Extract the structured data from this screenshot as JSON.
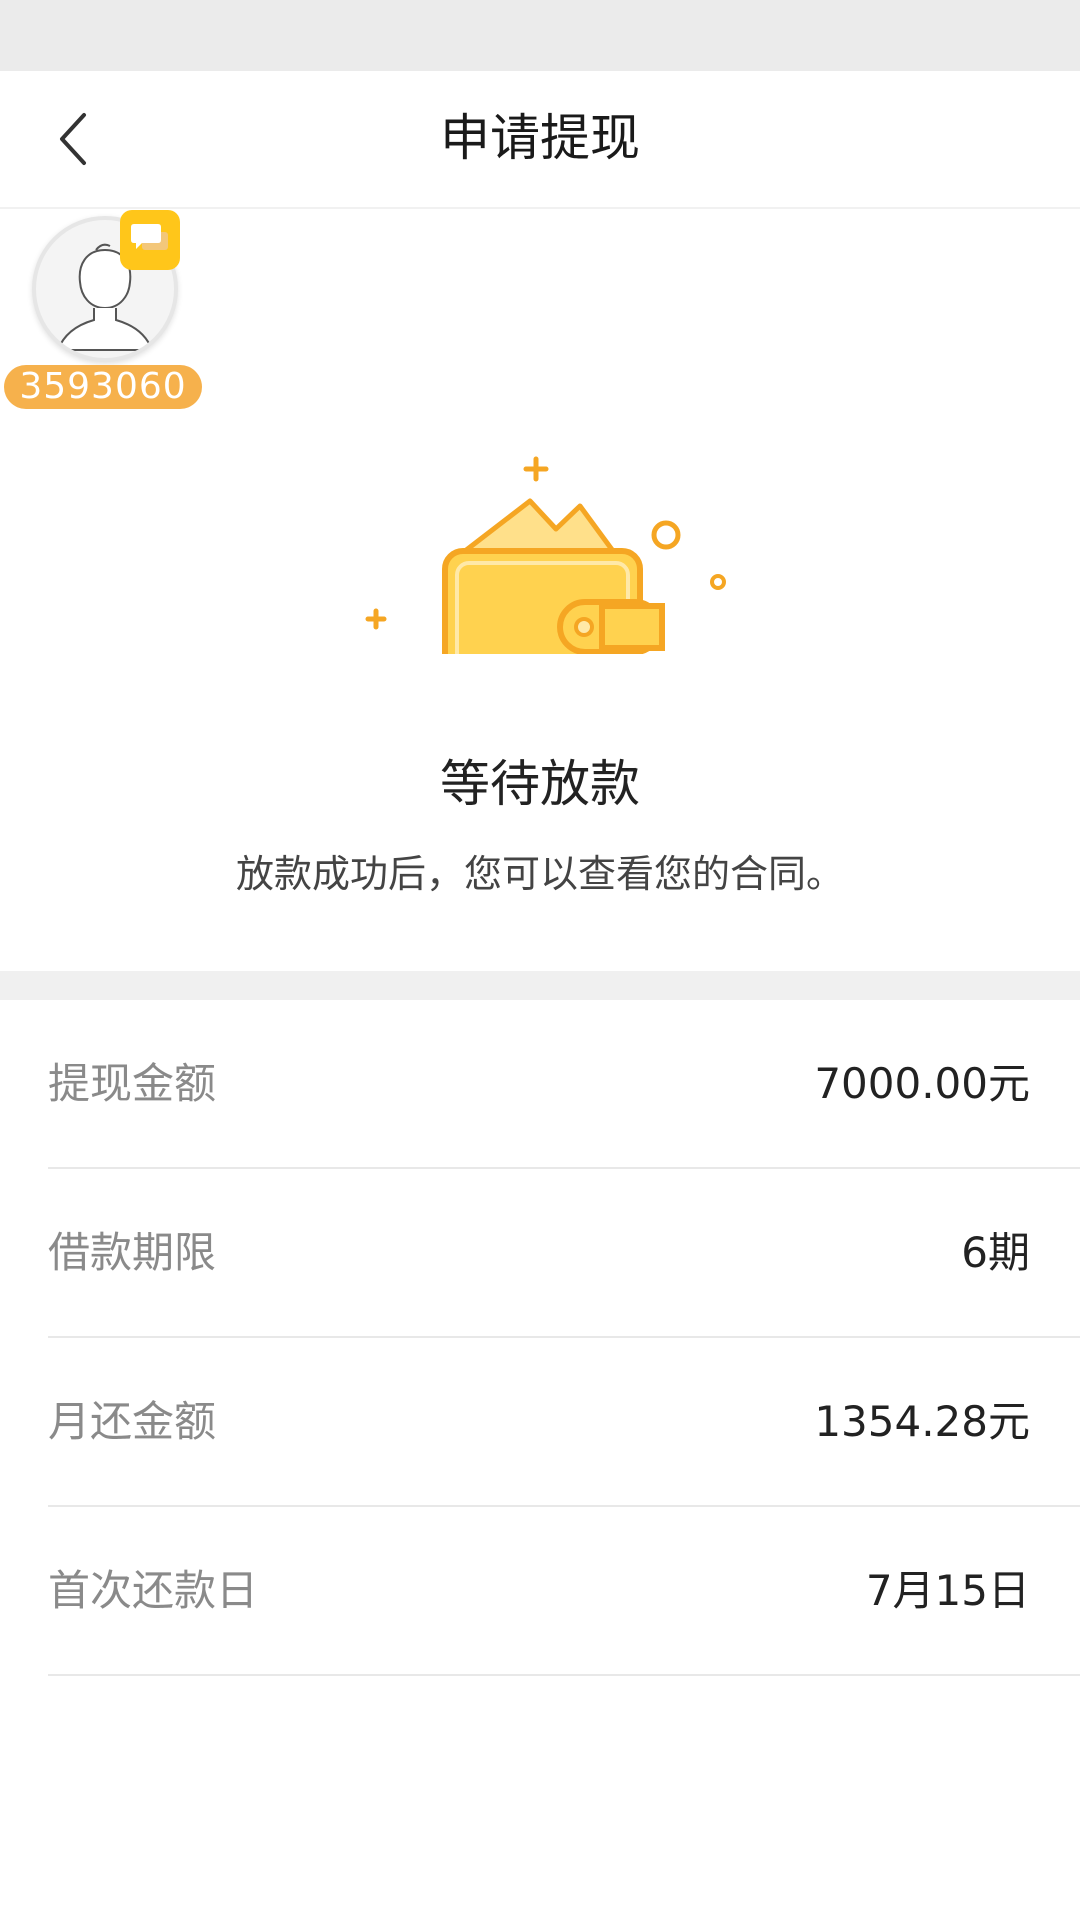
{
  "header": {
    "title": "申请提现",
    "back_icon": "chevron-left-icon"
  },
  "floating_widget": {
    "user_id": "3593060",
    "badge_icon": "chat-bubble-icon",
    "badge_color": "#ffc61a",
    "pill_color": "#f6b14c"
  },
  "status": {
    "title": "等待放款",
    "subtitle": "放款成功后，您可以查看您的合同。",
    "illustration_icon": "wallet-icon",
    "accent_color": "#f5a623",
    "wallet_fill": "#ffd24f"
  },
  "details": [
    {
      "label": "提现金额",
      "value": "7000.00元"
    },
    {
      "label": "借款期限",
      "value": "6期"
    },
    {
      "label": "月还金额",
      "value": "1354.28元"
    },
    {
      "label": "首次还款日",
      "value": "7月15日"
    }
  ]
}
